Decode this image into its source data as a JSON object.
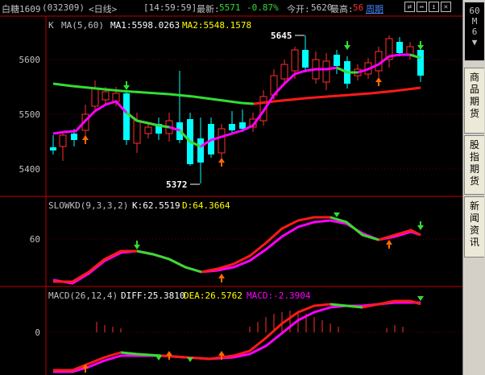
{
  "header": {
    "name": "白糖1609",
    "code": "(032309)",
    "period": "<日线>",
    "time": "[14:59:59]",
    "latest_label": "最新:",
    "latest_value": "5571",
    "change": "-0.87%",
    "open_label": "今开:",
    "open_value": "5620",
    "high_label": "最高:",
    "high_value": "56",
    "weekly_link": "周期",
    "buttons": [
      "⇄",
      "↔",
      "↥",
      "✕"
    ]
  },
  "sidebar": {
    "top_tab": "60\nM\n6\n▼",
    "tabs": [
      "商品期货",
      "股指期货",
      "新闻资讯"
    ],
    "corner_char": "∧"
  },
  "price_panel": {
    "legend_k": "K",
    "legend_ma": "MA(5,60)",
    "ma1": "MA1:5598.0263",
    "ma2": "MA2:5548.1578",
    "axis_labels": [
      "5600",
      "5500",
      "5400"
    ],
    "annot_high": "5645",
    "annot_low": "5372"
  },
  "kd_panel": {
    "title": "SLOWKD(9,3,3,2)",
    "k": "K:62.5519",
    "d": "D:64.3664",
    "axis_labels": [
      "60"
    ]
  },
  "macd_panel": {
    "title": "MACD(26,12,4)",
    "diff": "DIFF:25.3810",
    "dea": "DEA:26.5762",
    "macd": "MACD:-2.3904",
    "axis_labels": [
      "0"
    ]
  },
  "colors": {
    "up": "#ff3030",
    "down": "#00ffff",
    "ma_short": "#ff00ff",
    "ma_long": "#ff1a1a",
    "ma_green": "#33dd33",
    "divider": "#c00000",
    "axis_text": "#c0c0c0",
    "yellow": "#ffff00"
  }
}
